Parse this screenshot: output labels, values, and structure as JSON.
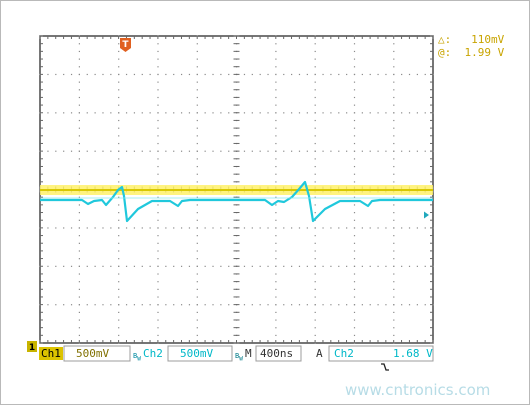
{
  "readouts": {
    "delta_symbol": "△:",
    "delta_value": "110mV",
    "at_symbol": "@:",
    "at_value": "1.99 V"
  },
  "trigger_marker": {
    "label": "T",
    "color": "#e06020"
  },
  "channel_marker": {
    "label": "1",
    "color": "#c8b400"
  },
  "status_bar": {
    "ch1_label": "Ch1",
    "ch1_scale": "500mV",
    "ch2_coupling_icon": "bw-icon",
    "ch2_label": "Ch2",
    "ch2_scale": "500mV",
    "m_coupling_icon": "bw-icon",
    "timebase_label": "M",
    "timebase_value": "400ns",
    "trigger_mode": "A",
    "trigger_source": "Ch2",
    "trigger_slope": "falling-edge-icon",
    "trigger_level": "1.68 V"
  },
  "watermark": "www.cntronics.com",
  "colors": {
    "ch1": "#e0d000",
    "ch2": "#20c8dc",
    "grid": "#7f7f7f",
    "readout": "#c8a400"
  }
}
